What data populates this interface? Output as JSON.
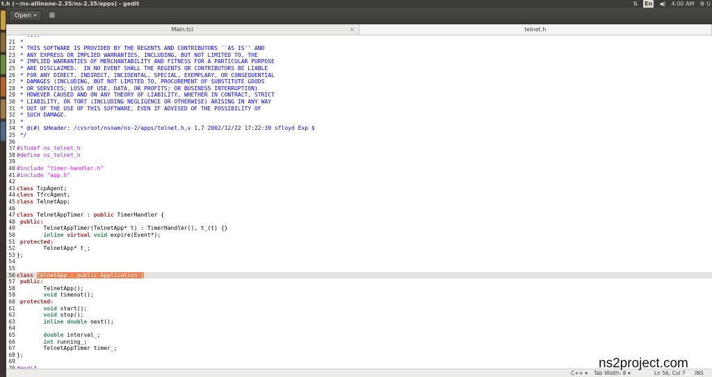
{
  "window": {
    "title": "t.h (~/ns-allinone-2.35/ns-2.35/apps) - gedit"
  },
  "system_tray": {
    "keyboard_layout": "En",
    "time": "4:00 AM",
    "user": "U"
  },
  "toolbar": {
    "open_label": "Open",
    "open_caret": "▾",
    "new_icon": "⊞"
  },
  "tabs": [
    {
      "label": "Main.tcl",
      "close": "×"
    },
    {
      "label": "telnet.h"
    }
  ],
  "editor": {
    "current_line": 56,
    "lines": [
      {
        "n": "",
        "tokens": [
          {
            "t": "comment",
            "s": " * ...."
          }
        ]
      },
      {
        "n": "21",
        "tokens": [
          {
            "t": "comment",
            "s": " *"
          }
        ]
      },
      {
        "n": "22",
        "tokens": [
          {
            "t": "comment",
            "s": " * THIS SOFTWARE IS PROVIDED BY THE REGENTS AND CONTRIBUTORS ``AS IS'' AND"
          }
        ]
      },
      {
        "n": "23",
        "tokens": [
          {
            "t": "comment",
            "s": " * ANY EXPRESS OR IMPLIED WARRANTIES, INCLUDING, BUT NOT LIMITED TO, THE"
          }
        ]
      },
      {
        "n": "24",
        "tokens": [
          {
            "t": "comment",
            "s": " * IMPLIED WARRANTIES OF MERCHANTABILITY AND FITNESS FOR A PARTICULAR PURPOSE"
          }
        ]
      },
      {
        "n": "25",
        "tokens": [
          {
            "t": "comment",
            "s": " * ARE DISCLAIMED.  IN NO EVENT SHALL THE REGENTS OR CONTRIBUTORS BE LIABLE"
          }
        ]
      },
      {
        "n": "26",
        "tokens": [
          {
            "t": "comment",
            "s": " * FOR ANY DIRECT, INDIRECT, INCIDENTAL, SPECIAL, EXEMPLARY, OR CONSEQUENTIAL"
          }
        ]
      },
      {
        "n": "27",
        "tokens": [
          {
            "t": "comment",
            "s": " * DAMAGES (INCLUDING, BUT NOT LIMITED TO, PROCUREMENT OF SUBSTITUTE GOODS"
          }
        ]
      },
      {
        "n": "28",
        "tokens": [
          {
            "t": "comment",
            "s": " * OR SERVICES; LOSS OF USE, DATA, OR PROFITS; OR BUSINESS INTERRUPTION)"
          }
        ]
      },
      {
        "n": "29",
        "tokens": [
          {
            "t": "comment",
            "s": " * HOWEVER CAUSED AND ON ANY THEORY OF LIABILITY, WHETHER IN CONTRACT, STRICT"
          }
        ]
      },
      {
        "n": "30",
        "tokens": [
          {
            "t": "comment",
            "s": " * LIABILITY, OR TORT (INCLUDING NEGLIGENCE OR OTHERWISE) ARISING IN ANY WAY"
          }
        ]
      },
      {
        "n": "31",
        "tokens": [
          {
            "t": "comment",
            "s": " * OUT OF THE USE OF THIS SOFTWARE, EVEN IF ADVISED OF THE POSSIBILITY OF"
          }
        ]
      },
      {
        "n": "32",
        "tokens": [
          {
            "t": "comment",
            "s": " * SUCH DAMAGE."
          }
        ]
      },
      {
        "n": "33",
        "tokens": [
          {
            "t": "comment",
            "s": " *"
          }
        ]
      },
      {
        "n": "34",
        "tokens": [
          {
            "t": "comment",
            "s": " * @(#) $Header: /cvsroot/nsnam/ns-2/apps/telnet.h,v 1.7 2002/12/22 17:22:39 sfloyd Exp $"
          }
        ]
      },
      {
        "n": "35",
        "tokens": [
          {
            "t": "comment",
            "s": " */"
          }
        ]
      },
      {
        "n": "36",
        "tokens": []
      },
      {
        "n": "37",
        "tokens": [
          {
            "t": "pre",
            "s": "#ifndef ns_telnet_h"
          }
        ]
      },
      {
        "n": "38",
        "tokens": [
          {
            "t": "pre",
            "s": "#define ns_telnet_h"
          }
        ]
      },
      {
        "n": "39",
        "tokens": []
      },
      {
        "n": "40",
        "tokens": [
          {
            "t": "pre",
            "s": "#include "
          },
          {
            "t": "str",
            "s": "\"timer-handler.h\""
          }
        ]
      },
      {
        "n": "41",
        "tokens": [
          {
            "t": "pre",
            "s": "#include "
          },
          {
            "t": "str",
            "s": "\"app.h\""
          }
        ]
      },
      {
        "n": "42",
        "tokens": []
      },
      {
        "n": "43",
        "tokens": [
          {
            "t": "kw",
            "s": "class"
          },
          {
            "t": "plain",
            "s": " TcpAgent;"
          }
        ]
      },
      {
        "n": "44",
        "tokens": [
          {
            "t": "kw",
            "s": "class"
          },
          {
            "t": "plain",
            "s": " TfrcAgent;"
          }
        ]
      },
      {
        "n": "45",
        "tokens": [
          {
            "t": "kw",
            "s": "class"
          },
          {
            "t": "plain",
            "s": " TelnetApp;"
          }
        ]
      },
      {
        "n": "46",
        "tokens": []
      },
      {
        "n": "47",
        "tokens": [
          {
            "t": "kw",
            "s": "class"
          },
          {
            "t": "plain",
            "s": " TelnetAppTimer : "
          },
          {
            "t": "kw",
            "s": "public"
          },
          {
            "t": "plain",
            "s": " TimerHandler {"
          }
        ]
      },
      {
        "n": "48",
        "tokens": [
          {
            "t": "kw",
            "s": " public:"
          }
        ]
      },
      {
        "n": "49",
        "tokens": [
          {
            "t": "plain",
            "s": "        TelnetAppTimer(TelnetApp* t) : TimerHandler(), t_(t) {}"
          }
        ]
      },
      {
        "n": "50",
        "tokens": [
          {
            "t": "plain",
            "s": "        "
          },
          {
            "t": "type",
            "s": "inline"
          },
          {
            "t": "plain",
            "s": " "
          },
          {
            "t": "kw",
            "s": "virtual"
          },
          {
            "t": "plain",
            "s": " "
          },
          {
            "t": "type",
            "s": "void"
          },
          {
            "t": "plain",
            "s": " expire(Event*);"
          }
        ]
      },
      {
        "n": "51",
        "tokens": [
          {
            "t": "kw",
            "s": " protected:"
          }
        ]
      },
      {
        "n": "52",
        "tokens": [
          {
            "t": "plain",
            "s": "        TelnetApp* t_;"
          }
        ]
      },
      {
        "n": "53",
        "tokens": [
          {
            "t": "plain",
            "s": "};"
          }
        ]
      },
      {
        "n": "54",
        "tokens": []
      },
      {
        "n": "55",
        "tokens": []
      },
      {
        "n": "56",
        "tokens": [
          {
            "t": "kw",
            "s": "class"
          },
          {
            "t": "plain",
            "s": " "
          },
          {
            "t": "sel",
            "s": "TelnetApp : public Application {"
          }
        ]
      },
      {
        "n": "57",
        "tokens": [
          {
            "t": "kw",
            "s": " public:"
          }
        ]
      },
      {
        "n": "58",
        "tokens": [
          {
            "t": "plain",
            "s": "        TelnetApp();"
          }
        ]
      },
      {
        "n": "59",
        "tokens": [
          {
            "t": "plain",
            "s": "        "
          },
          {
            "t": "type",
            "s": "void"
          },
          {
            "t": "plain",
            "s": " timeout();"
          }
        ]
      },
      {
        "n": "60",
        "tokens": [
          {
            "t": "kw",
            "s": " protected:"
          }
        ]
      },
      {
        "n": "61",
        "tokens": [
          {
            "t": "plain",
            "s": "        "
          },
          {
            "t": "type",
            "s": "void"
          },
          {
            "t": "plain",
            "s": " start();"
          }
        ]
      },
      {
        "n": "62",
        "tokens": [
          {
            "t": "plain",
            "s": "        "
          },
          {
            "t": "type",
            "s": "void"
          },
          {
            "t": "plain",
            "s": " stop();"
          }
        ]
      },
      {
        "n": "63",
        "tokens": [
          {
            "t": "plain",
            "s": "        "
          },
          {
            "t": "type",
            "s": "inline"
          },
          {
            "t": "plain",
            "s": " "
          },
          {
            "t": "type",
            "s": "double"
          },
          {
            "t": "plain",
            "s": " next();"
          }
        ]
      },
      {
        "n": "64",
        "tokens": []
      },
      {
        "n": "65",
        "tokens": [
          {
            "t": "plain",
            "s": "        "
          },
          {
            "t": "type",
            "s": "double"
          },
          {
            "t": "plain",
            "s": " interval_;"
          }
        ]
      },
      {
        "n": "66",
        "tokens": [
          {
            "t": "plain",
            "s": "        "
          },
          {
            "t": "type",
            "s": "int"
          },
          {
            "t": "plain",
            "s": " running_;"
          }
        ]
      },
      {
        "n": "67",
        "tokens": [
          {
            "t": "plain",
            "s": "        TelnetAppTimer timer_;"
          }
        ]
      },
      {
        "n": "68",
        "tokens": [
          {
            "t": "plain",
            "s": "};"
          }
        ]
      },
      {
        "n": "69",
        "tokens": []
      },
      {
        "n": "70",
        "tokens": [
          {
            "t": "pre",
            "s": "#endif"
          }
        ]
      }
    ]
  },
  "statusbar": {
    "language": "C++",
    "language_caret": "▾",
    "tab_width": "Tab Width: 8",
    "tab_caret": "▾",
    "cursor": "Ln 56, Col 7",
    "ins": "INS"
  },
  "watermark": "ns2project.com",
  "colors": {
    "comment": "#0000ff",
    "preprocessor": "#a020f0",
    "string": "#ff00ff",
    "keyword": "#a52a2a",
    "type": "#2e8b57",
    "selection": "#f08050"
  }
}
